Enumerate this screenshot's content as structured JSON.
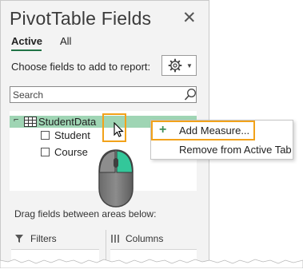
{
  "pane": {
    "title": "PivotTable Fields",
    "tabs": [
      {
        "label": "Active",
        "active": true
      },
      {
        "label": "All",
        "active": false
      }
    ],
    "choose_label": "Choose fields to add to report:",
    "search_placeholder": "Search",
    "table": {
      "expander": "⌐",
      "name": "StudentData",
      "fields": [
        "Student",
        "Course"
      ]
    },
    "drag_text": "Drag fields between areas below:",
    "areas": [
      {
        "label": "Filters",
        "icon": "filter-icon"
      },
      {
        "label": "Columns",
        "icon": "columns-icon"
      }
    ]
  },
  "context_menu": {
    "items": [
      {
        "label": "Add Measure...",
        "icon": "plus-icon",
        "highlighted": true
      },
      {
        "label": "Remove from Active Tab"
      }
    ]
  },
  "colors": {
    "accent_green": "#217346",
    "row_highlight": "#9fd5b4",
    "callout_orange": "#f2a21a",
    "mouse_button": "#33c79a"
  }
}
